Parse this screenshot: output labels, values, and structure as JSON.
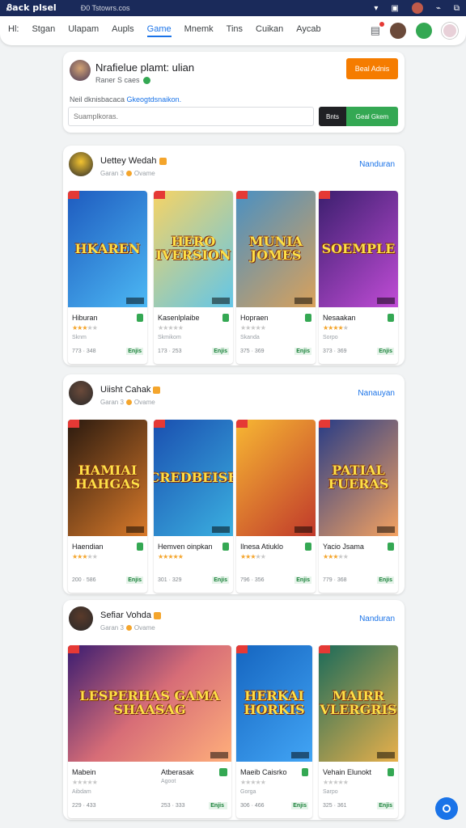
{
  "sysbar": {
    "brand": "Ᏸack plsel",
    "url": "Đ0 Tstowrs.cos"
  },
  "nav": {
    "tabs": [
      "Hl:",
      "Stgan",
      "Ulapam",
      "Aupls",
      "Game",
      "Mnemk",
      "Tins",
      "Cuikan",
      "Aycab"
    ],
    "active": 4
  },
  "hero": {
    "title": "Nrafielue plamt: ulian",
    "sub": "Raner S caes",
    "button": "Beal Adnis",
    "prompt_plain": "Neil dknisbacaca ",
    "prompt_link": "Gkeogtdsnaikon.",
    "search_placeholder": "Suamplkoras.",
    "dark_btn": "Bnts",
    "green_btn": "Geal Gkem"
  },
  "sections": [
    {
      "title": "Uettey Wedah",
      "sub_a": "Garan 3",
      "sub_b": "Ovame",
      "more": "Nanduran",
      "avatar_color": "#f4c430",
      "tiles": [
        {
          "art": "HKAREN",
          "name": "Hiburan",
          "stars": 3,
          "meta": "Sknm",
          "price": "773 · 348",
          "get": "Enjis",
          "bg": "linear-gradient(135deg,#1e5bbf,#4cb8f4)"
        },
        {
          "art": "HERO IVERSION",
          "name": "Kasenlplaibe",
          "stars": 0,
          "meta": "Skmikom",
          "price": "173 · 253",
          "get": "Enjis",
          "bg": "linear-gradient(135deg,#f6d365,#62c6e8)"
        },
        {
          "art": "MUNIA JOMES",
          "name": "Hopraen",
          "stars": 0,
          "meta": "Skanda",
          "price": "375 · 369",
          "get": "Enjis",
          "bg": "linear-gradient(135deg,#4a90c2,#d9a15b)"
        },
        {
          "art": "SOEMPLE",
          "name": "Nesaakan",
          "stars": 4,
          "meta": "Sorpo",
          "price": "373 · 369",
          "get": "Enjis",
          "bg": "linear-gradient(135deg,#3b1f6e,#c04cd6)"
        }
      ]
    },
    {
      "title": "Uiisht Cahak",
      "sub_a": "Garan 3",
      "sub_b": "Ovame",
      "more": "Nanauyan",
      "avatar_color": "#6b4a3a",
      "tiles": [
        {
          "art": "HAMIAI HAHGAS",
          "name": "Haendian",
          "stars": 3,
          "meta": "",
          "price": "200 · 586",
          "get": "Enjis",
          "bg": "linear-gradient(135deg,#2b1a0f,#d97a2a)"
        },
        {
          "art": "CREDBEISE",
          "name": "Hemven oinpkan",
          "stars": 5,
          "meta": "",
          "price": "301 · 329",
          "get": "Enjis",
          "bg": "linear-gradient(135deg,#1a4fb0,#3bb0e0)"
        },
        {
          "art": "",
          "name": "Ilnesa Atiuklo",
          "stars": 3,
          "meta": "",
          "price": "796 · 356",
          "get": "Enjis",
          "bg": "linear-gradient(135deg,#f7b733,#c0392b)"
        },
        {
          "art": "PATIAL FUERAS",
          "name": "Yacio Jsama",
          "stars": 3,
          "meta": "",
          "price": "779 · 368",
          "get": "Enjis",
          "bg": "linear-gradient(135deg,#283c86,#f4a261)"
        }
      ]
    },
    {
      "title": "Sefiar Vohda",
      "sub_a": "Garan 3",
      "sub_b": "Ovame",
      "more": "Nanduran",
      "avatar_color": "#5a3a2a",
      "tiles": [
        {
          "art": "LESPERHAS GAMA SHAASAG",
          "name": "Mabein",
          "stars": 0,
          "meta": "Aibdam",
          "price": "229 · 433",
          "get": "Enjis",
          "bg": "linear-gradient(135deg,#3a1c71,#d76d77,#ffaf7b)"
        },
        {
          "art": "",
          "name": "Atberasak",
          "stars": 0,
          "meta": "Agoot",
          "price": "253 · 333",
          "get": "Enjis",
          "bg": "transparent"
        },
        {
          "art": "HERKAI HORKIS",
          "name": "Maeib Caisrko",
          "stars": 0,
          "meta": "Gorga",
          "price": "306 · 466",
          "get": "Enjis",
          "bg": "linear-gradient(135deg,#1565c0,#42a5f5)"
        },
        {
          "art": "MAIRR VLERGRIS",
          "name": "Vehain Elunokt",
          "stars": 0,
          "meta": "Sarpo",
          "price": "325 · 361",
          "get": "Enjis",
          "bg": "linear-gradient(135deg,#1b6b5a,#e8b04b)"
        }
      ]
    }
  ]
}
